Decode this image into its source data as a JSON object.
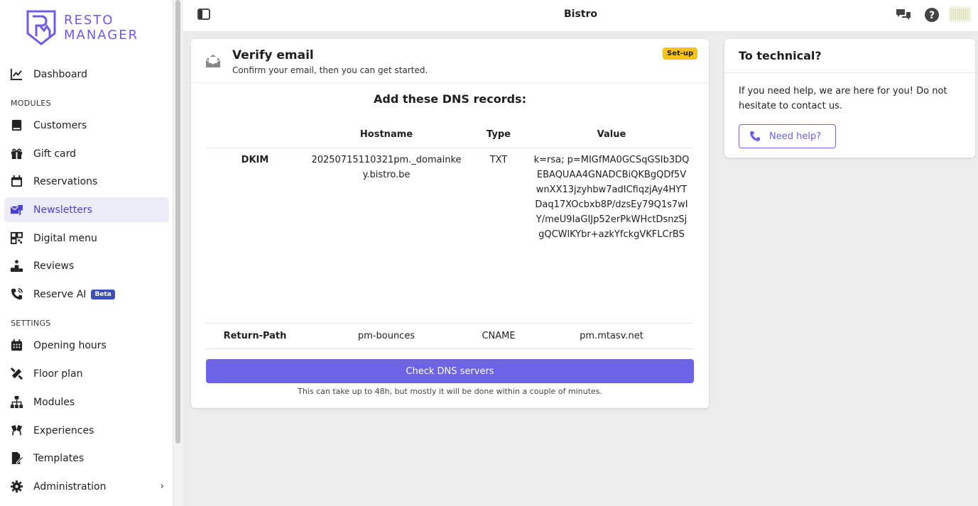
{
  "app": {
    "logo_line1": "RESTO",
    "logo_line2": "MANAGER",
    "title": "Bistro"
  },
  "sidebar": {
    "dashboard": "Dashboard",
    "modules_label": "MODULES",
    "modules": [
      {
        "label": "Customers",
        "icon": "book-icon"
      },
      {
        "label": "Gift card",
        "icon": "gift-icon"
      },
      {
        "label": "Reservations",
        "icon": "calendar-icon"
      },
      {
        "label": "Newsletters",
        "icon": "mail-icon",
        "active": true
      },
      {
        "label": "Digital menu",
        "icon": "qr-icon"
      },
      {
        "label": "Reviews",
        "icon": "podium-icon"
      },
      {
        "label": "Reserve AI",
        "icon": "phone-icon",
        "badge": "Beta"
      }
    ],
    "settings_label": "SETTINGS",
    "settings": [
      {
        "label": "Opening hours",
        "icon": "calendar-grid-icon"
      },
      {
        "label": "Floor plan",
        "icon": "ruler-icon"
      },
      {
        "label": "Modules",
        "icon": "sitemap-icon"
      },
      {
        "label": "Experiences",
        "icon": "cheers-icon"
      },
      {
        "label": "Templates",
        "icon": "file-edit-icon"
      },
      {
        "label": "Administration",
        "icon": "gear-icon",
        "chevron": "›"
      }
    ]
  },
  "verify": {
    "title": "Verify email",
    "subtitle": "Confirm your email, then you can get started.",
    "badge": "Set-up",
    "dns_title": "Add these DNS records:",
    "headers": {
      "hostname": "Hostname",
      "type": "Type",
      "value": "Value"
    },
    "rows": [
      {
        "name": "DKIM",
        "hostname": "20250715110321pm._domainkey.bistro.be",
        "type": "TXT",
        "value": "k=rsa; p=MIGfMA0GCSqGSIb3DQEBAQUAA4GNADCBiQKBgQDf5VwnXX13jzyhbw7adICfiqzjAy4HYTDaq17XOcbxb8P/dzsEy79Q1s7wIY/meU9IaGIJp52erPkWHctDsnzSjgQCWlKYbr+azkYfckgVKFLCrBS"
      },
      {
        "name": "Return-Path",
        "hostname": "pm-bounces",
        "type": "CNAME",
        "value": "pm.mtasv.net"
      }
    ],
    "button": "Check DNS servers",
    "note": "This can take up to 48h, but mostly it will be done within a couple of minutes."
  },
  "help": {
    "title": "To technical?",
    "body": "If you need help, we are here for you! Do not hesitate to contact us.",
    "button": "Need help?"
  },
  "colors": {
    "accent": "#6c63e6",
    "badge": "#f6c21a",
    "active_bg": "#ecebf8",
    "beta": "#3f4fb8"
  }
}
